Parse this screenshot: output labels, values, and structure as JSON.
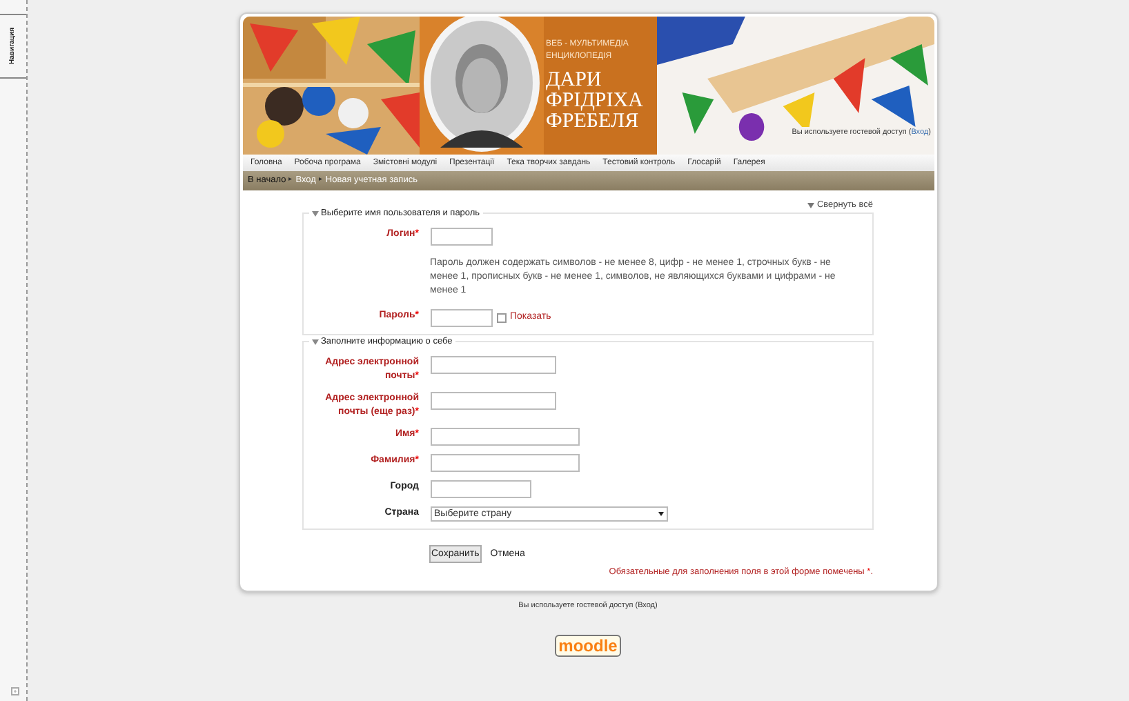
{
  "sidebar": {
    "tab": "Навигация"
  },
  "header": {
    "tagline": [
      "ВЕБ - МУЛЬТИМЕДІА",
      "ЕНЦИКЛОПЕДІЯ"
    ],
    "title_lines": [
      "ДАРИ",
      "ФРІДРІХА",
      "ФРЕБЕЛЯ"
    ],
    "login_info": {
      "before": "Вы используете гостевой доступ (",
      "link": "Вход",
      "after": ")"
    }
  },
  "nav": [
    "Головна",
    "Робоча програма",
    "Змістовні модулі",
    "Презентації",
    "Тека творчих завдань",
    "Тестовий контроль",
    "Глосарій",
    "Галерея"
  ],
  "breadcrumb": {
    "separator": "▸",
    "items": [
      {
        "label": "В начало",
        "kind": "home"
      },
      {
        "label": "Вход",
        "kind": "link"
      },
      {
        "label": "Новая учетная запись",
        "kind": "link"
      }
    ]
  },
  "collapse_all": "Свернуть всё",
  "required_mark": "*",
  "sections": [
    {
      "title": "Выберите имя пользователя и пароль",
      "expanded": true,
      "fields": [
        {
          "kind": "text",
          "label": "Логин",
          "required": true
        },
        {
          "kind": "note",
          "text": "Пароль должен содержать символов - не менее 8, цифр - не менее 1, строчных букв - не менее 1, прописных букв - не менее 1, символов, не являющихся буквами и цифрами - не менее 1"
        },
        {
          "kind": "password",
          "label": "Пароль",
          "required": true,
          "toggle": {
            "label": "Показать",
            "checked": false
          }
        }
      ]
    },
    {
      "title": "Заполните информацию о себе",
      "expanded": true,
      "fields": [
        {
          "kind": "text",
          "label": "Адрес электронной почты",
          "required": true
        },
        {
          "kind": "text",
          "label": "Адрес электронной почты (еще раз)",
          "required": true
        },
        {
          "kind": "text",
          "label": "Имя",
          "required": true
        },
        {
          "kind": "text",
          "label": "Фамилия",
          "required": true
        },
        {
          "kind": "text",
          "label": "Город",
          "required": false
        },
        {
          "kind": "select",
          "label": "Страна",
          "required": false,
          "value": "Выберите страну"
        }
      ]
    }
  ],
  "buttons": [
    {
      "label": "Сохранить",
      "kind": "primary"
    },
    {
      "label": "Отмена",
      "kind": "plain"
    }
  ],
  "required_note": {
    "text": "Обязательные для заполнения поля в этой форме помечены ",
    "end": "."
  },
  "footer": {
    "login_info": "Вы используете гостевой доступ (Вход)",
    "logo": "moodle"
  }
}
